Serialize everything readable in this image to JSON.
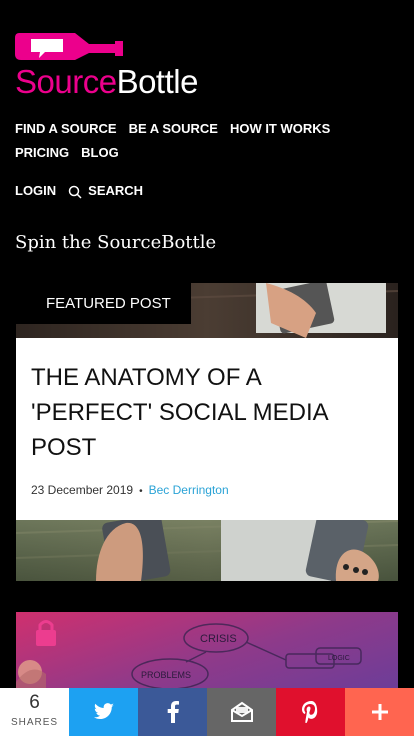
{
  "brand": {
    "part1": "Source",
    "part2": "Bottle",
    "pink": "#ec008c"
  },
  "nav": {
    "items": [
      "FIND A SOURCE",
      "BE A SOURCE",
      "HOW IT WORKS",
      "PRICING",
      "BLOG"
    ],
    "login": "LOGIN",
    "search": "SEARCH"
  },
  "tagline": "Spin the SourceBottle",
  "featured": {
    "badge": "FEATURED POST",
    "title": "THE ANATOMY OF A 'PERFECT' SOCIAL MEDIA POST",
    "date": "23 December 2019",
    "separator": "•",
    "author": "Bec Derrington"
  },
  "promo_words": [
    "CRISIS",
    "PROBLEMS",
    "LOGIC"
  ],
  "share": {
    "count": "6",
    "label": "SHARES",
    "buttons": [
      {
        "name": "twitter",
        "color": "#1da1f2"
      },
      {
        "name": "facebook",
        "color": "#3b5998"
      },
      {
        "name": "email",
        "color": "#666666"
      },
      {
        "name": "pinterest",
        "color": "#e0102d"
      },
      {
        "name": "more",
        "color": "#ff6550"
      }
    ]
  }
}
